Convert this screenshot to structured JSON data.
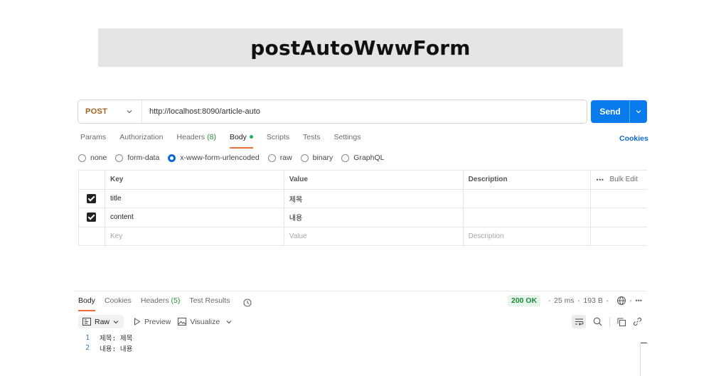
{
  "banner": {
    "title": "postAutoWwwForm"
  },
  "request": {
    "method": "POST",
    "url": "http://localhost:8090/article-auto",
    "send_label": "Send"
  },
  "request_tabs": [
    {
      "label": "Params",
      "active": false
    },
    {
      "label": "Authorization",
      "active": false
    },
    {
      "label": "Headers",
      "count": "(8)",
      "active": false
    },
    {
      "label": "Body",
      "active": true,
      "indicator": "green-dot"
    },
    {
      "label": "Scripts",
      "active": false
    },
    {
      "label": "Tests",
      "active": false
    },
    {
      "label": "Settings",
      "active": false
    }
  ],
  "cookies_link": "Cookies",
  "body_types": [
    {
      "label": "none",
      "selected": false
    },
    {
      "label": "form-data",
      "selected": false
    },
    {
      "label": "x-www-form-urlencoded",
      "selected": true
    },
    {
      "label": "raw",
      "selected": false
    },
    {
      "label": "binary",
      "selected": false
    },
    {
      "label": "GraphQL",
      "selected": false
    }
  ],
  "table": {
    "headers": {
      "key": "Key",
      "value": "Value",
      "description": "Description",
      "bulk_edit": "Bulk Edit",
      "more": "•••"
    },
    "rows": [
      {
        "checked": true,
        "key": "title",
        "value": "제목",
        "description": ""
      },
      {
        "checked": true,
        "key": "content",
        "value": "내용",
        "description": ""
      }
    ],
    "placeholders": {
      "key": "Key",
      "value": "Value",
      "description": "Description"
    }
  },
  "response_tabs": [
    {
      "label": "Body",
      "active": true
    },
    {
      "label": "Cookies",
      "active": false
    },
    {
      "label": "Headers",
      "count": "(5)",
      "active": false
    },
    {
      "label": "Test Results",
      "active": false
    }
  ],
  "response_meta": {
    "status": "200 OK",
    "time": "25 ms",
    "size": "193 B",
    "more": "•••"
  },
  "response_toolbar": {
    "format": "Raw",
    "preview": "Preview",
    "visualize": "Visualize"
  },
  "response_body": [
    {
      "line": "1",
      "text": "제목: 제목"
    },
    {
      "line": "2",
      "text": "내용: 내용"
    }
  ],
  "colors": {
    "send": "#097bed",
    "method": "#a2631a",
    "active_tab": "#f26b3a",
    "status_ok": "#1c8a3b",
    "link": "#0b68d8"
  },
  "icons": [
    "chevron-down-icon",
    "history-icon",
    "globe-icon",
    "more-icon",
    "raw-format-icon",
    "play-icon",
    "image-icon",
    "wrap-lines-icon",
    "search-icon",
    "copy-icon",
    "link-icon"
  ]
}
